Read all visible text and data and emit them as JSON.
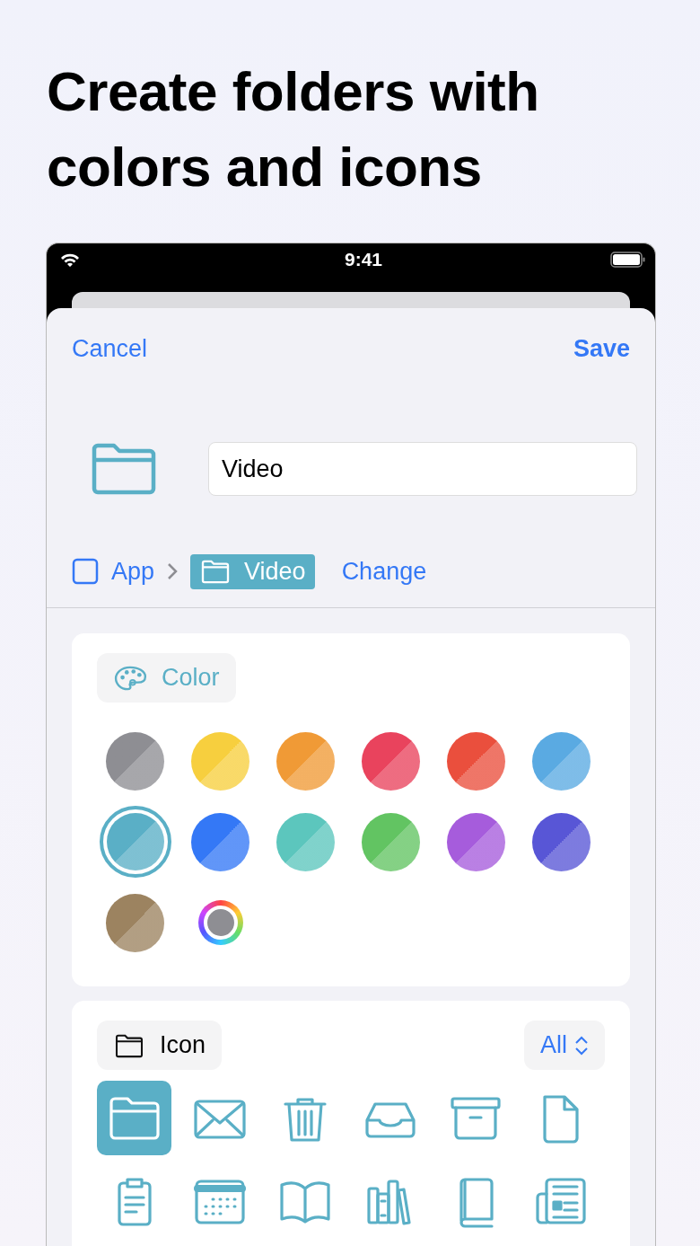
{
  "headline": "Create folders with colors and icons",
  "status_bar": {
    "time": "9:41"
  },
  "nav": {
    "cancel": "Cancel",
    "save": "Save"
  },
  "name_field": {
    "value": "Video"
  },
  "breadcrumb": {
    "parent": "App",
    "current": "Video",
    "action": "Change"
  },
  "color_section": {
    "title": "Color",
    "swatches": [
      {
        "kind": "color",
        "color": "#8e8e93",
        "selected": false
      },
      {
        "kind": "color",
        "color": "#f7cf3e",
        "selected": false
      },
      {
        "kind": "color",
        "color": "#f09a36",
        "selected": false
      },
      {
        "kind": "color",
        "color": "#e9435d",
        "selected": false
      },
      {
        "kind": "color",
        "color": "#ea4f3d",
        "selected": false
      },
      {
        "kind": "color",
        "color": "#5aaae2",
        "selected": false
      },
      {
        "kind": "color",
        "color": "#5aafc6",
        "selected": true
      },
      {
        "kind": "color",
        "color": "#3478f6",
        "selected": false
      },
      {
        "kind": "color",
        "color": "#5cc6bd",
        "selected": false
      },
      {
        "kind": "color",
        "color": "#62c462",
        "selected": false
      },
      {
        "kind": "color",
        "color": "#a65cdc",
        "selected": false
      },
      {
        "kind": "color",
        "color": "#5856d6",
        "selected": false
      },
      {
        "kind": "color",
        "color": "#9c8360",
        "selected": false
      },
      {
        "kind": "custom",
        "selected": false
      }
    ]
  },
  "icon_section": {
    "title": "Icon",
    "filter": "All",
    "icons": [
      {
        "kind": "folder",
        "selected": true
      },
      {
        "kind": "envelope",
        "selected": false
      },
      {
        "kind": "trash",
        "selected": false
      },
      {
        "kind": "tray",
        "selected": false
      },
      {
        "kind": "archive",
        "selected": false
      },
      {
        "kind": "document",
        "selected": false
      },
      {
        "kind": "clipboard",
        "selected": false
      },
      {
        "kind": "calendar",
        "selected": false
      },
      {
        "kind": "book",
        "selected": false
      },
      {
        "kind": "books",
        "selected": false
      },
      {
        "kind": "closed-book",
        "selected": false
      },
      {
        "kind": "newspaper",
        "selected": false
      }
    ]
  }
}
